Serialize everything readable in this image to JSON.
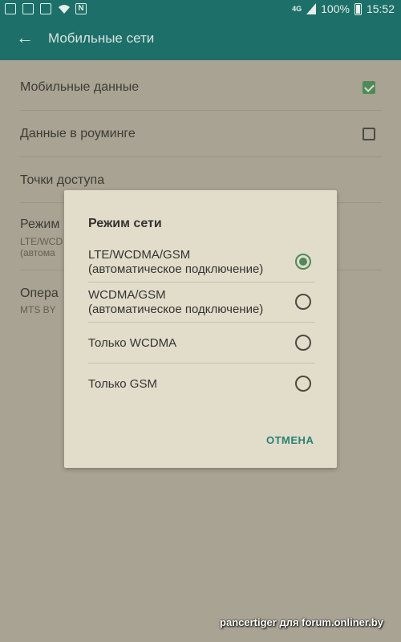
{
  "status_bar": {
    "network": "4G",
    "battery": "100%",
    "time": "15:52",
    "icons": [
      "settings-icon",
      "gallery-icon",
      "mail-icon",
      "wifi-icon",
      "nfc-icon"
    ]
  },
  "app_bar": {
    "title": "Мобильные сети"
  },
  "settings": {
    "mobile_data": "Мобильные данные",
    "roaming": "Данные в роуминге",
    "access_points": "Точки доступа",
    "network_mode_title": "Режим",
    "network_mode_sub1": "LTE/WCD",
    "network_mode_sub2": "(автома",
    "operator_title": "Опера",
    "operator_sub": "MTS BY"
  },
  "dialog": {
    "title": "Режим сети",
    "options": [
      {
        "line1": "LTE/WCDMA/GSM",
        "line2": "(автоматическое подключение)",
        "selected": true
      },
      {
        "line1": "WCDMA/GSM",
        "line2": "(автоматическое подключение)",
        "selected": false
      },
      {
        "line1": "Только WCDMA",
        "line2": "",
        "selected": false
      },
      {
        "line1": "Только GSM",
        "line2": "",
        "selected": false
      }
    ],
    "cancel": "ОТМЕНА"
  },
  "watermark": "pancertiger для forum.onliner.by",
  "colors": {
    "app_bar": "#1d6f69",
    "dialog_bg": "#e2ddcb",
    "accent": "#4e8a5a",
    "cancel_text": "#2a8073"
  }
}
